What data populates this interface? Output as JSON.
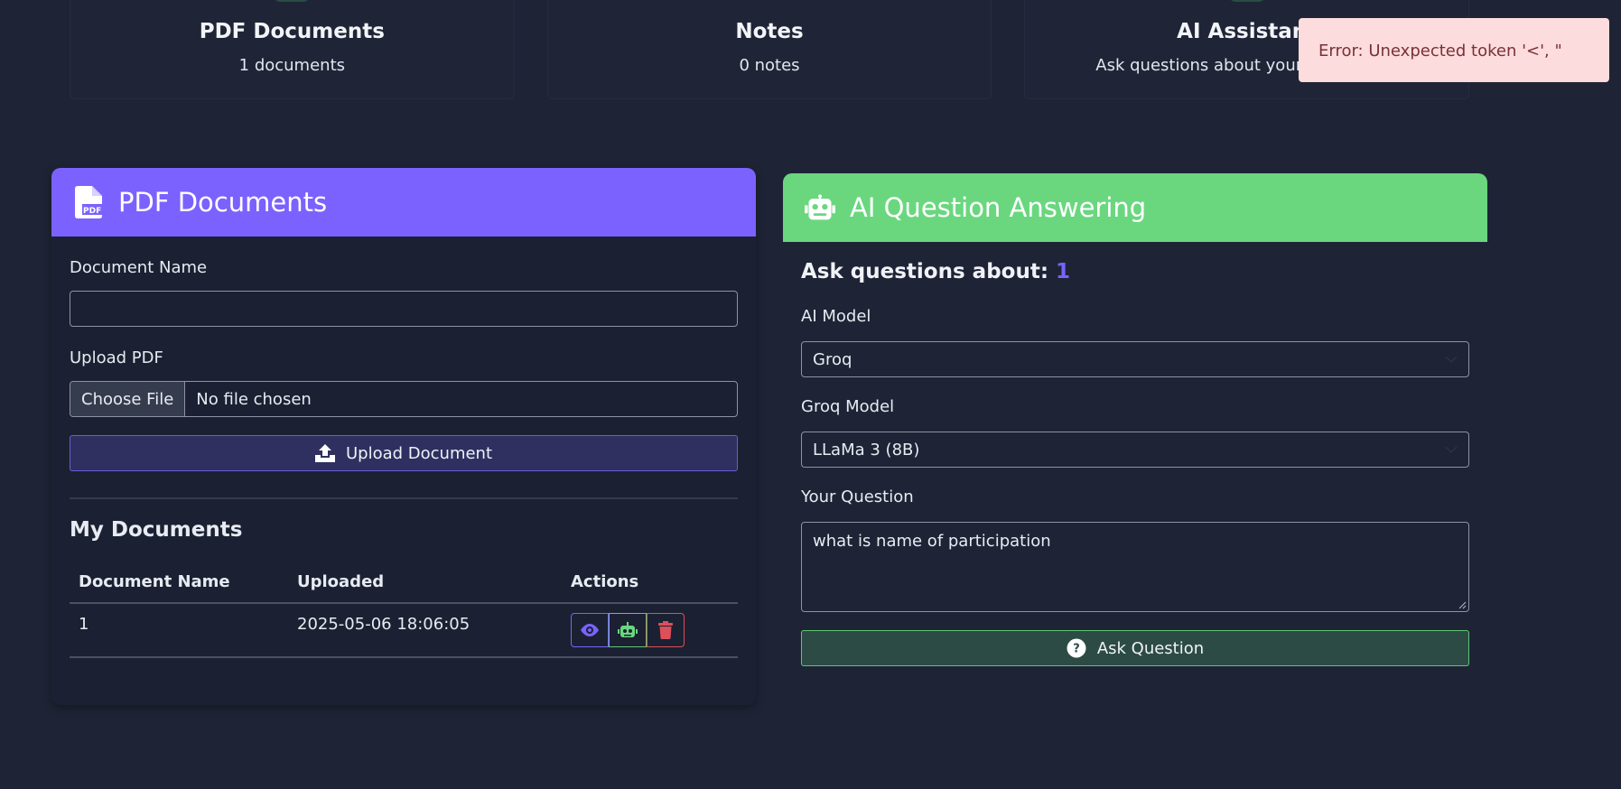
{
  "stats": [
    {
      "title": "PDF Documents",
      "sub": "1 documents"
    },
    {
      "title": "Notes",
      "sub": "0 notes"
    },
    {
      "title": "AI Assistant",
      "sub": "Ask questions about your documents"
    }
  ],
  "toast": {
    "message": "Error: Unexpected token '<', \""
  },
  "pdf_panel": {
    "title": "PDF Documents",
    "doc_name_label": "Document Name",
    "doc_name_value": "",
    "upload_label": "Upload PDF",
    "choose_file": "Choose File",
    "no_file": "No file chosen",
    "upload_button": "Upload Document",
    "my_documents": "My Documents",
    "table": {
      "headers": [
        "Document Name",
        "Uploaded",
        "Actions"
      ],
      "rows": [
        {
          "name": "1",
          "uploaded": "2025-05-06 18:06:05"
        }
      ]
    }
  },
  "ai_panel": {
    "title": "AI Question Answering",
    "ask_about_label": "Ask questions about:",
    "ask_about_doc": "1",
    "model_label": "AI Model",
    "model_value": "Groq",
    "groq_label": "Groq Model",
    "groq_value": "LLaMa 3 (8B)",
    "question_label": "Your Question",
    "question_value": "what is name of participation",
    "ask_button": "Ask Question"
  },
  "colors": {
    "purple": "#7b62fe",
    "green": "#6ad77f",
    "red": "#dc4f5b",
    "background": "#1e2435"
  }
}
